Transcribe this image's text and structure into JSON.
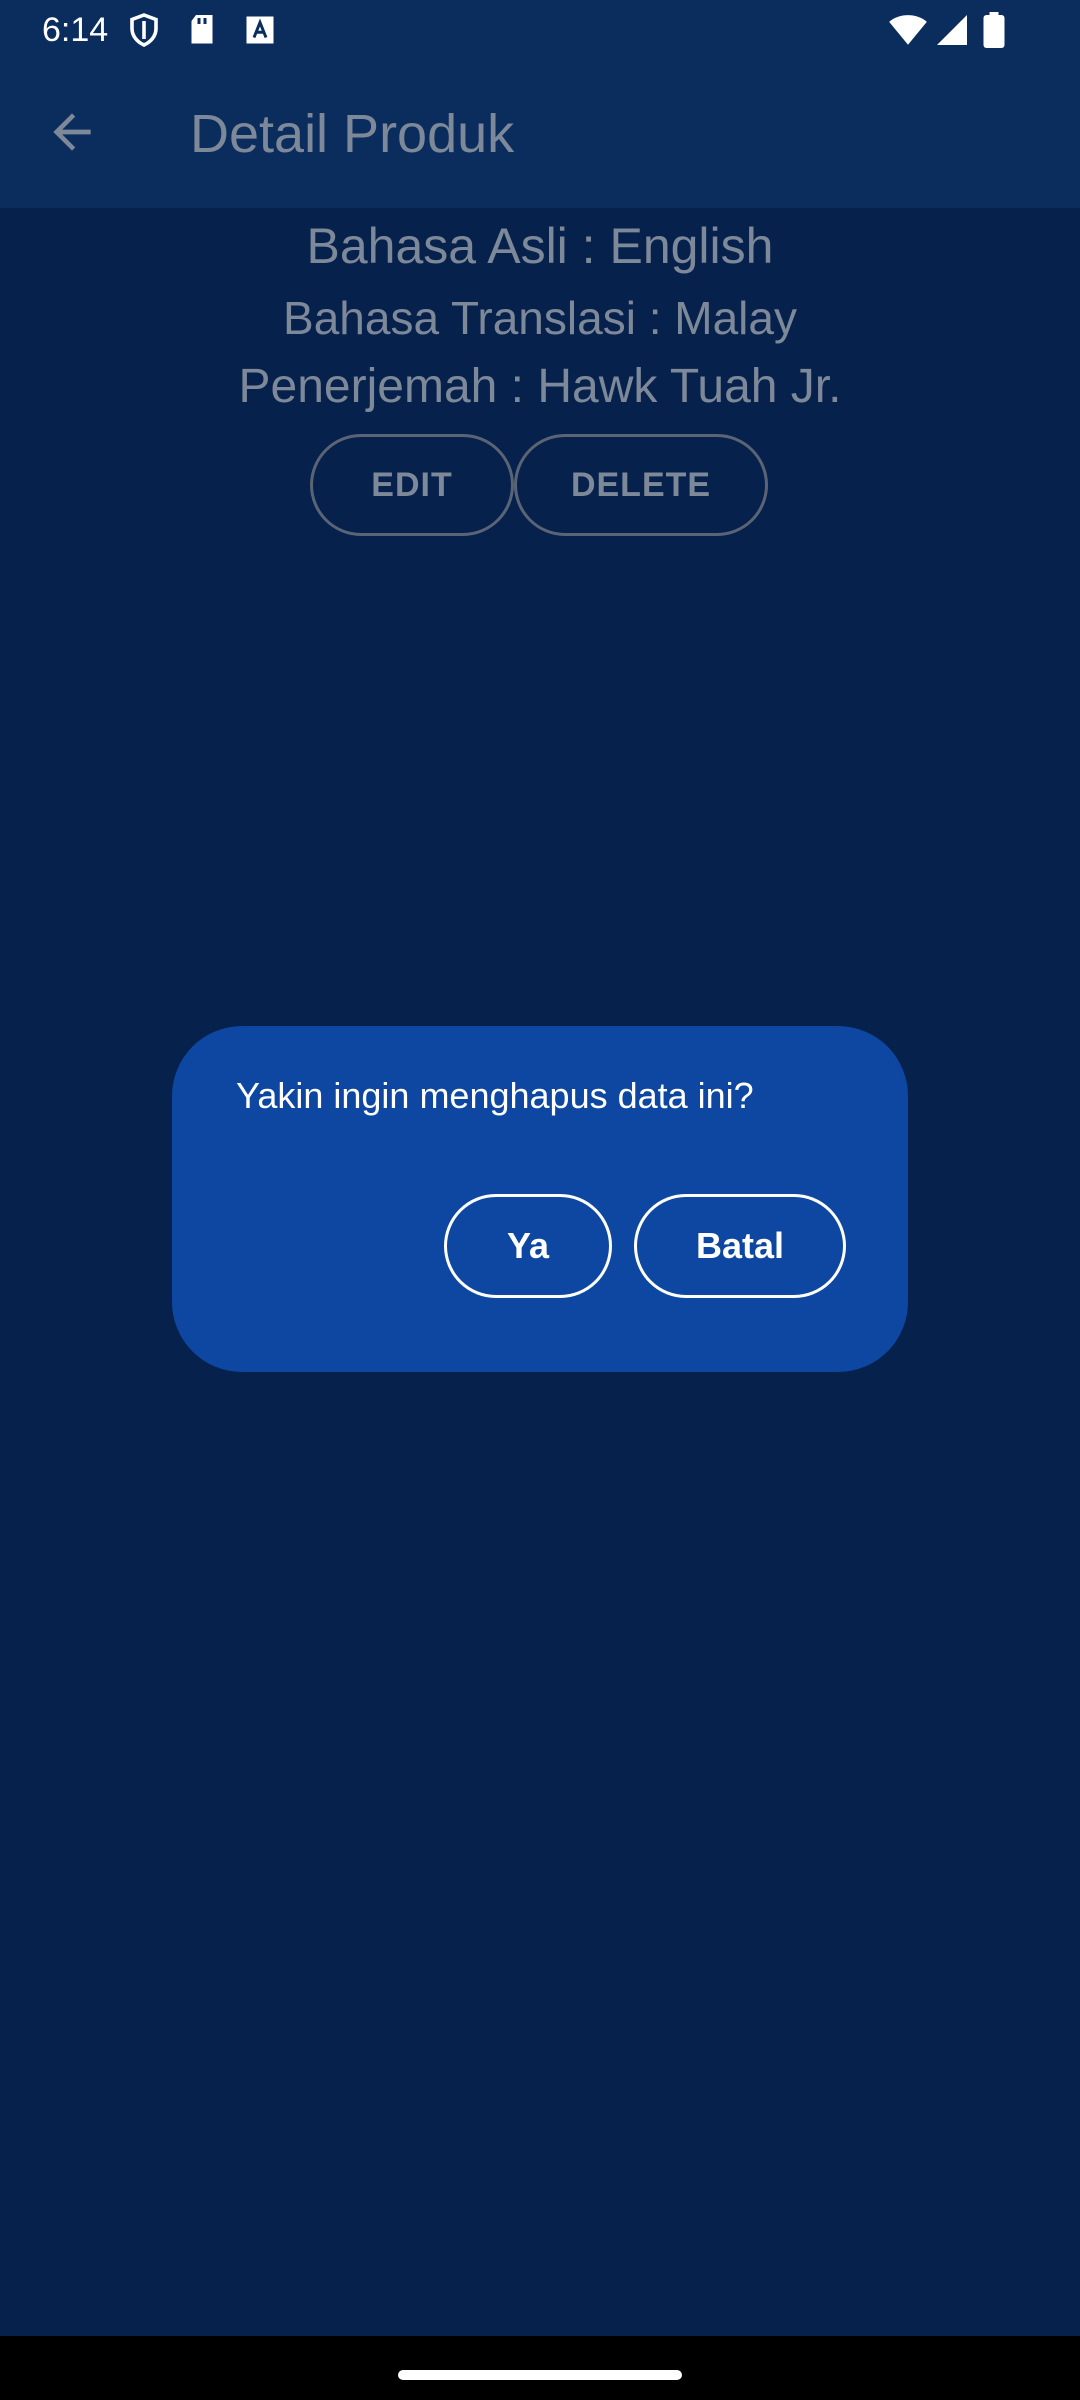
{
  "status_bar": {
    "time": "6:14",
    "icons": [
      "shield-icon",
      "sd-card-icon",
      "font-a-icon",
      "wifi-icon",
      "signal-icon",
      "battery-icon"
    ]
  },
  "app_bar": {
    "back_icon": "arrow-back-icon",
    "title": "Detail Produk"
  },
  "details": {
    "original_language": "Bahasa Asli : English",
    "translation_language": "Bahasa Translasi : Malay",
    "translator": "Penerjemah : Hawk Tuah Jr."
  },
  "actions": {
    "edit_label": "EDIT",
    "delete_label": "DELETE"
  },
  "dialog": {
    "message": "Yakin ingin menghapus data ini?",
    "confirm_label": "Ya",
    "cancel_label": "Batal"
  },
  "colors": {
    "background": "#07214d",
    "app_bar": "#0b2d5e",
    "dialog": "#0d47a1",
    "dimmed_text": "#7d8898"
  }
}
